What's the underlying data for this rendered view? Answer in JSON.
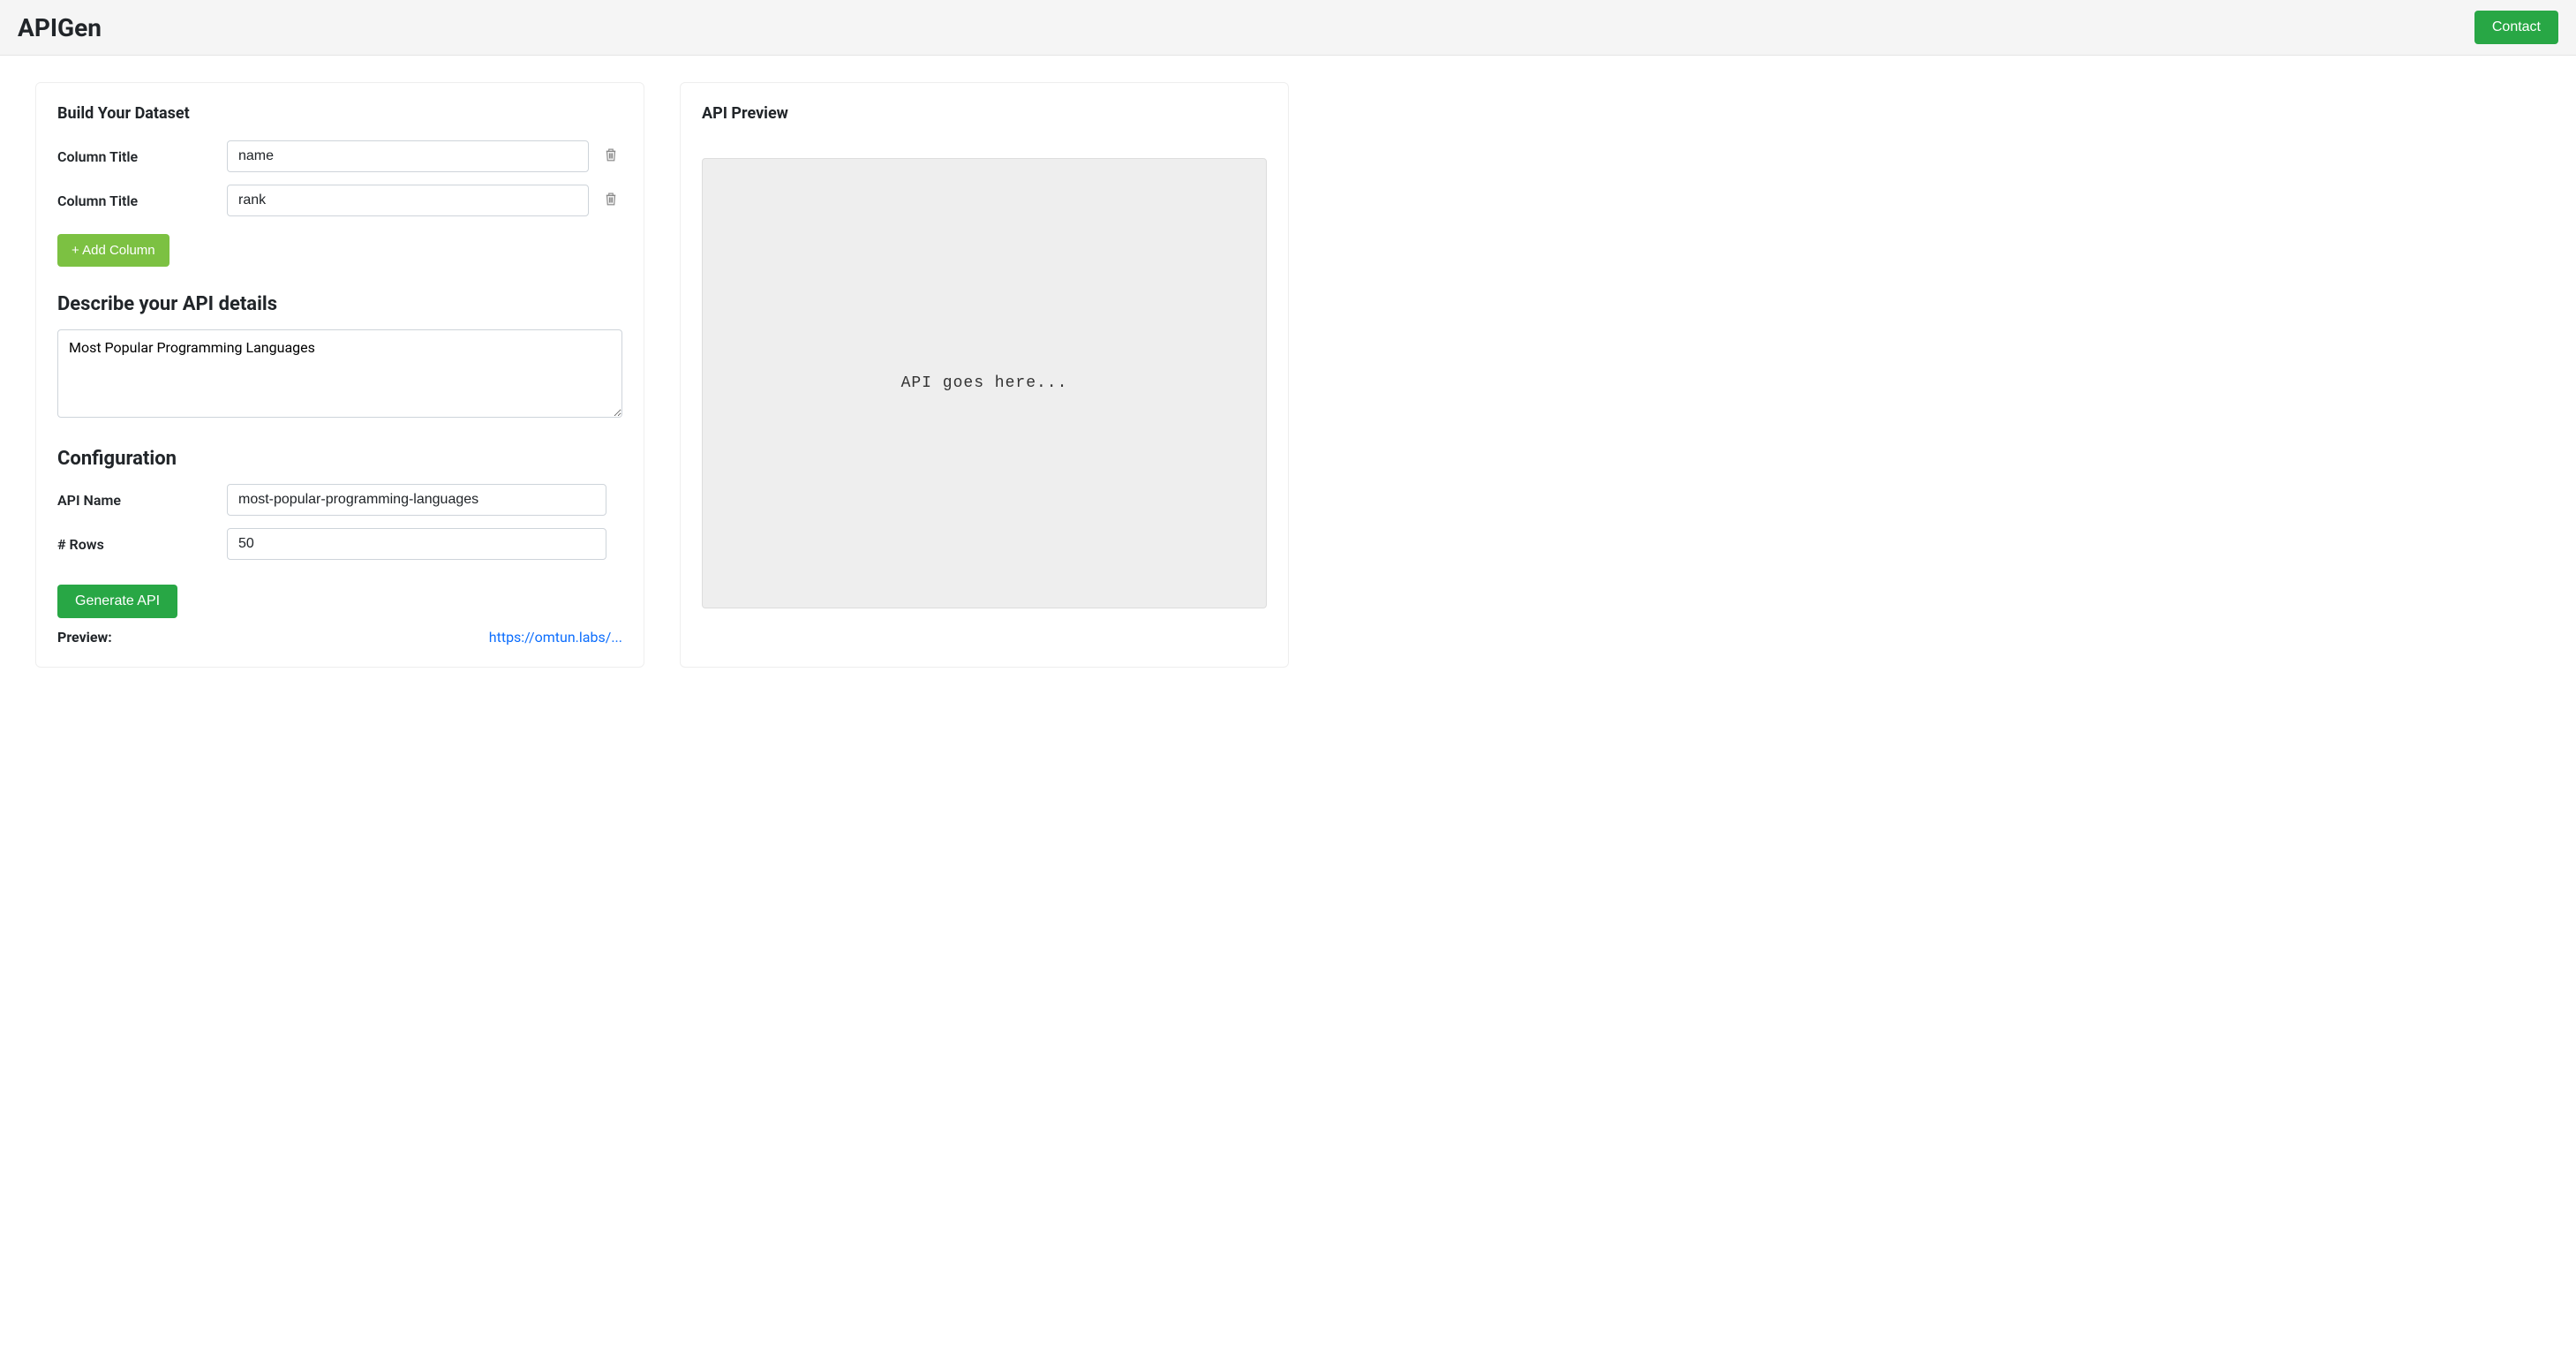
{
  "header": {
    "logo": "APIGen",
    "contact_label": "Contact"
  },
  "build_section": {
    "title": "Build Your Dataset",
    "column_label": "Column Title",
    "columns": [
      {
        "value": "name"
      },
      {
        "value": "rank"
      }
    ],
    "add_column_label": "+ Add Column"
  },
  "describe_section": {
    "heading": "Describe your API details",
    "value": "Most Popular Programming Languages"
  },
  "config_section": {
    "heading": "Configuration",
    "api_name_label": "API Name",
    "api_name_value": "most-popular-programming-languages",
    "rows_label": "# Rows",
    "rows_value": "50",
    "generate_label": "Generate API",
    "preview_label": "Preview:",
    "preview_link_text": "https://omtun.labs/..."
  },
  "api_preview": {
    "title": "API Preview",
    "placeholder": "API goes here..."
  }
}
